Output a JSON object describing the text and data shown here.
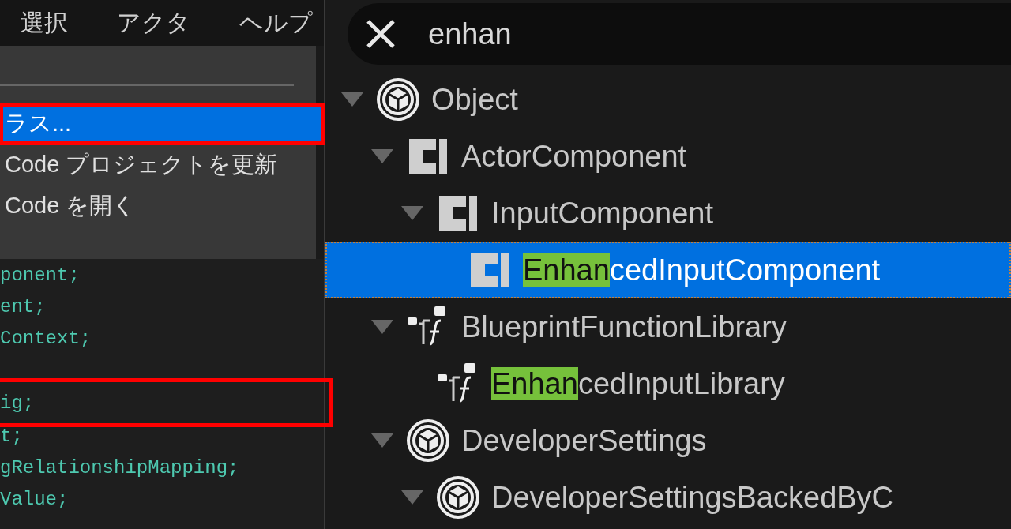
{
  "menubar": {
    "items": [
      {
        "label": "選択"
      },
      {
        "label": "アクタ"
      },
      {
        "label": "ヘルプ"
      }
    ]
  },
  "menu": {
    "items": [
      {
        "kind": "separator"
      },
      {
        "kind": "item",
        "label": "ラス...",
        "selected": true,
        "annotated": true
      },
      {
        "kind": "item",
        "label": "Code プロジェクトを更新",
        "selected": false,
        "annotated": false
      },
      {
        "kind": "item",
        "label": "Code を開く",
        "selected": false,
        "annotated": false
      }
    ]
  },
  "code": {
    "lines": [
      {
        "text": "ponent;",
        "annotated": false
      },
      {
        "text": "ent;",
        "annotated": false
      },
      {
        "text": "Context;",
        "annotated": false
      },
      {
        "annotated": false
      },
      {
        "text": "ig;",
        "annotated": true
      },
      {
        "text": "t;",
        "annotated": false
      },
      {
        "text": "gRelationshipMapping;",
        "annotated": false
      },
      {
        "text": "Value;",
        "annotated": false
      }
    ]
  },
  "class_picker": {
    "search": {
      "value": "enhan"
    },
    "tree": [
      {
        "kind": "cube",
        "label": "Object",
        "expanded": true,
        "selected": false,
        "children": [
          {
            "kind": "class",
            "label": "ActorComponent",
            "expanded": true,
            "selected": false,
            "children": [
              {
                "kind": "class",
                "label": "InputComponent",
                "expanded": true,
                "selected": false,
                "children": [
                  {
                    "kind": "class",
                    "highlight": "Enhan",
                    "label": "cedInputComponent",
                    "selected": true
                  }
                ]
              }
            ]
          },
          {
            "kind": "function",
            "label": "BlueprintFunctionLibrary",
            "expanded": true,
            "selected": false,
            "children": [
              {
                "kind": "function",
                "highlight": "Enhan",
                "label": "cedInputLibrary",
                "selected": false
              }
            ]
          },
          {
            "kind": "cube",
            "label": "DeveloperSettings",
            "expanded": true,
            "selected": false,
            "children": [
              {
                "kind": "cube",
                "label": "DeveloperSettingsBackedByC",
                "expanded": true,
                "selected": false
              }
            ]
          }
        ]
      }
    ]
  }
}
